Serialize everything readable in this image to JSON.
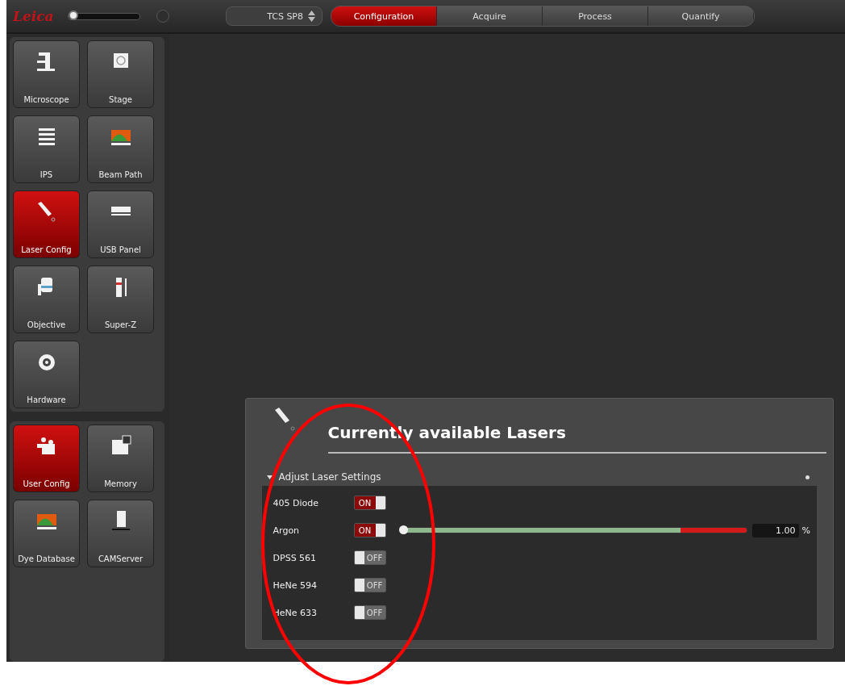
{
  "topbar": {
    "logo": "Leica",
    "zoom": {
      "level": 0.0
    },
    "instrument": "TCS SP8",
    "steps": [
      {
        "label": "Configuration",
        "selected": true
      },
      {
        "label": "Acquire",
        "selected": false
      },
      {
        "label": "Process",
        "selected": false
      },
      {
        "label": "Quantify",
        "selected": false
      }
    ]
  },
  "sidebar": {
    "groups": [
      [
        {
          "label": "Microscope",
          "kind": "microscope",
          "selected": false
        },
        {
          "label": "Stage",
          "kind": "stage",
          "selected": false
        },
        {
          "label": "IPS",
          "kind": "list",
          "selected": false
        },
        {
          "label": "Beam Path",
          "kind": "spectrum",
          "selected": false
        },
        {
          "label": "Laser Config",
          "kind": "laser",
          "selected": true
        },
        {
          "label": "USB Panel",
          "kind": "panel",
          "selected": false
        },
        {
          "label": "Objective",
          "kind": "objective",
          "selected": false
        },
        {
          "label": "Super-Z",
          "kind": "superz",
          "selected": false
        },
        {
          "label": "Hardware",
          "kind": "gear",
          "selected": false
        }
      ],
      [
        {
          "label": "User Config",
          "kind": "users",
          "selected": true
        },
        {
          "label": "Memory",
          "kind": "memory",
          "selected": false
        },
        {
          "label": "Dye Database",
          "kind": "spectrum",
          "selected": false
        },
        {
          "label": "CAMServer",
          "kind": "server",
          "selected": false
        }
      ]
    ]
  },
  "panel": {
    "title": "Currently available Lasers",
    "section": {
      "label": "Adjust Laser Settings",
      "expanded": true
    },
    "lasers": [
      {
        "name": "405 Diode",
        "on": true,
        "switch_label": "ON"
      },
      {
        "name": "Argon",
        "on": true,
        "switch_label": "ON",
        "power": {
          "level": 0.01,
          "value": "1.00",
          "unit": "%"
        }
      },
      {
        "name": "DPSS 561",
        "on": false,
        "switch_label": "OFF"
      },
      {
        "name": "HeNe 594",
        "on": false,
        "switch_label": "OFF"
      },
      {
        "name": "HeNe 633",
        "on": false,
        "switch_label": "OFF"
      }
    ]
  },
  "annotations": [
    {
      "kind": "ellipse"
    }
  ]
}
